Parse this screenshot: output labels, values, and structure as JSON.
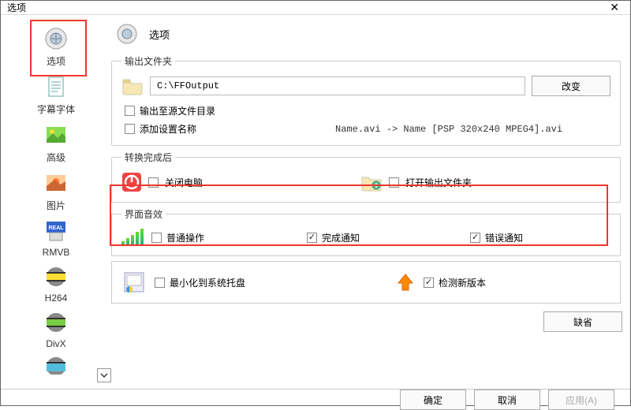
{
  "window": {
    "title": "选项"
  },
  "sidebar": {
    "items": [
      {
        "label": "选项"
      },
      {
        "label": "字幕字体"
      },
      {
        "label": "高级"
      },
      {
        "label": "图片"
      },
      {
        "label": "RMVB"
      },
      {
        "label": "H264"
      },
      {
        "label": "DivX"
      }
    ]
  },
  "header": {
    "title": "选项"
  },
  "output": {
    "legend": "输出文件夹",
    "path": "C:\\FFOutput",
    "change_btn": "改变",
    "chk_source": "输出至源文件目录",
    "chk_addname": "添加设置名称",
    "example": "Name.avi  -> Name [PSP 320x240 MPEG4].avi"
  },
  "after": {
    "legend": "转换完成后",
    "shutdown": "关闭电脑",
    "openfolder": "打开输出文件夹"
  },
  "sound": {
    "legend": "界面音效",
    "normal": "普通操作",
    "done": "完成通知",
    "error": "错误通知"
  },
  "misc": {
    "tray": "最小化到系统托盘",
    "check_update": "检测新版本",
    "default_btn": "缺省"
  },
  "footer": {
    "ok": "确定",
    "cancel": "取消",
    "apply": "应用(A)"
  }
}
